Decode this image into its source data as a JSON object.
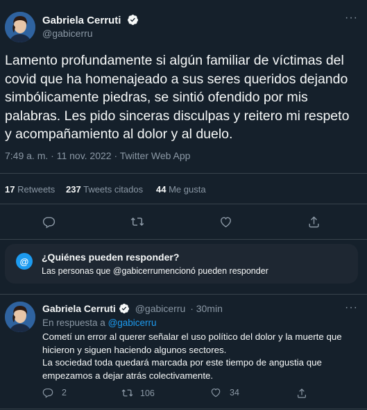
{
  "main_tweet": {
    "author_name": "Gabriela Cerruti",
    "author_handle": "@gabicerru",
    "text": "Lamento profundamente si algún familiar de víctimas del covid que ha homenajeado  a sus seres queridos dejando simbólicamente piedras, se sintió ofendido por mis palabras. Les pido sinceras disculpas y reitero mi respeto y acompañamiento al dolor y al duelo.",
    "meta": "7:49 a. m. · 11 nov. 2022 · Twitter Web App",
    "stats": {
      "retweets_count": "17",
      "retweets_label": "Retweets",
      "quotes_count": "237",
      "quotes_label": "Tweets citados",
      "likes_count": "44",
      "likes_label": "Me gusta"
    }
  },
  "reply_restriction": {
    "title": "¿Quiénes pueden responder?",
    "desc_prefix": "Las personas que ",
    "desc_handle": "@gabicerru",
    "desc_suffix": "mencionó pueden responder"
  },
  "reply_tweet": {
    "author_name": "Gabriela Cerruti",
    "author_handle": "@gabicerru",
    "time": "· 30min",
    "in_reply_prefix": "En respuesta a ",
    "in_reply_handle": "@gabicerru",
    "text_1": "Cometí un error al querer señalar el uso político del dolor y la muerte que hicieron y siguen haciendo algunos sectores.",
    "text_2": "La sociedad toda quedará marcada por este tiempo de angustia que empezamos a dejar atrás colectivamente.",
    "replies": "2",
    "retweets": "106",
    "likes": "34"
  },
  "colors": {
    "background": "#15202b",
    "accent": "#1d9bf0",
    "muted": "#8b98a5",
    "divider": "#38444d"
  }
}
